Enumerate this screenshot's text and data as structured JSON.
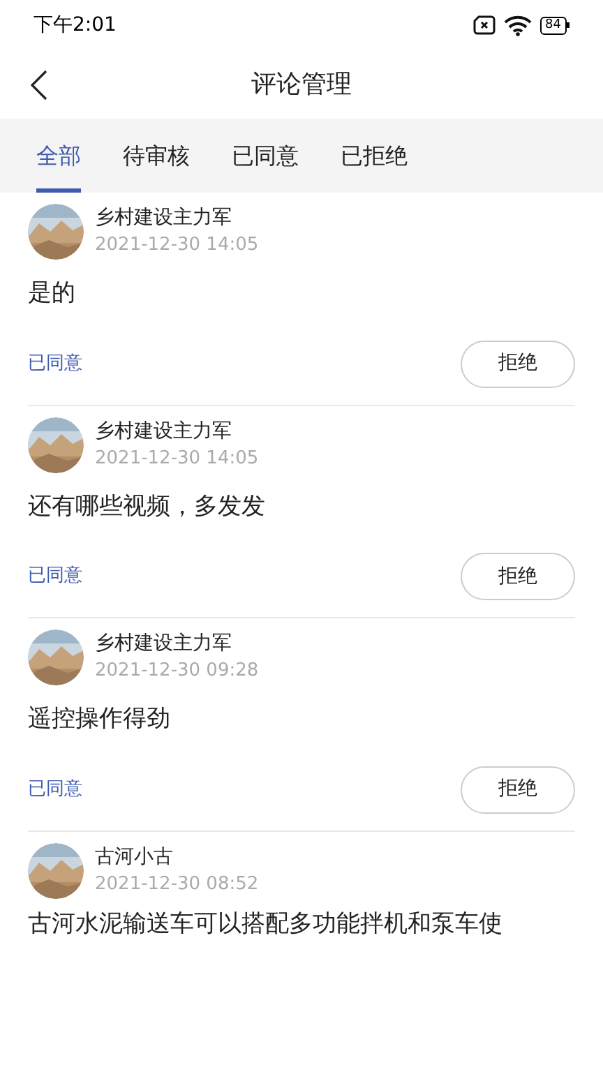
{
  "status_bar": {
    "time": "下午2:01",
    "battery": "84"
  },
  "header": {
    "title": "评论管理"
  },
  "tabs": [
    {
      "label": "全部",
      "selected": true
    },
    {
      "label": "待审核",
      "selected": false
    },
    {
      "label": "已同意",
      "selected": false
    },
    {
      "label": "已拒绝",
      "selected": false
    }
  ],
  "comments": [
    {
      "author": "乡村建设主力军",
      "time": "2021-12-30 14:05",
      "text": "是的",
      "status": "已同意",
      "action": "拒绝"
    },
    {
      "author": "乡村建设主力军",
      "time": "2021-12-30 14:05",
      "text": "还有哪些视频，多发发",
      "status": "已同意",
      "action": "拒绝"
    },
    {
      "author": "乡村建设主力军",
      "time": "2021-12-30 09:28",
      "text": "遥控操作得劲",
      "status": "已同意",
      "action": "拒绝"
    },
    {
      "author": "古河小古",
      "time": "2021-12-30 08:52",
      "text": "古河水泥输送车可以搭配多功能拌机和泵车使"
    }
  ]
}
